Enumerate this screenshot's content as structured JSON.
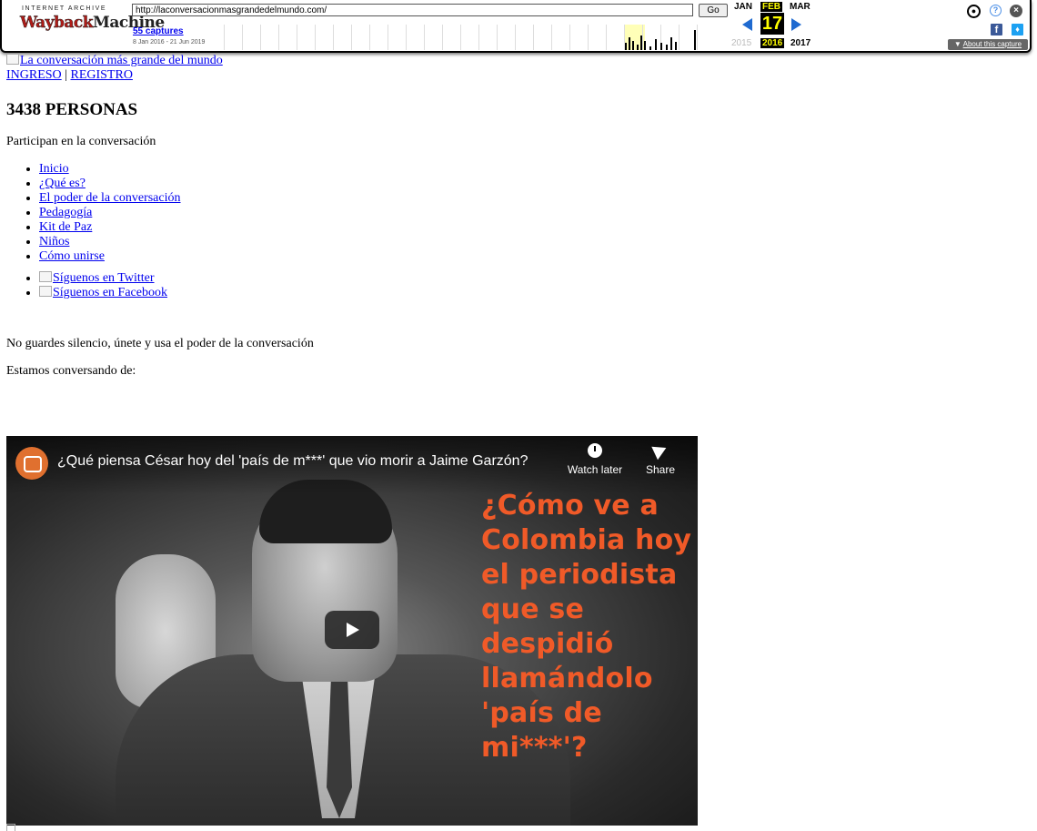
{
  "wayback": {
    "ia_label": "INTERNET ARCHIVE",
    "wb_logo_1": "Wayback",
    "wb_logo_2": "Machine",
    "url": "http://laconversacionmasgrandedelmundo.com/",
    "go_label": "Go",
    "captures": "55 captures",
    "date_range": "8 Jan 2016 - 21 Jun 2019",
    "months": {
      "prev": "JAN",
      "current": "FEB",
      "next": "MAR"
    },
    "day": "17",
    "years": {
      "prev": "2015",
      "current": "2016",
      "next": "2017"
    },
    "about": "About this capture",
    "icons": [
      "user-icon",
      "help-icon",
      "close-icon",
      "facebook-icon",
      "twitter-icon"
    ]
  },
  "site": {
    "logo_alt": "La conversación más grande del mundo",
    "login": "INGRESO",
    "separator": " | ",
    "register": "REGISTRO",
    "count_heading": "3438 PERSONAS",
    "count_sub": "Participan en la conversación",
    "nav": [
      "Inicio",
      "¿Qué es?",
      "El poder de la conversación",
      "Pedagogía",
      "Kit de Paz",
      "Niños",
      "Cómo unirse"
    ],
    "social": [
      "Síguenos en Twitter",
      "Síguenos en Facebook"
    ],
    "tagline": "No guardes silencio, únete y usa el poder de la conversación",
    "conversing": "Estamos conversando de:"
  },
  "video": {
    "title": "¿Qué piensa César hoy del 'país de m***' que vio morir a Jaime Garzón?",
    "watch_later": "Watch later",
    "share": "Share",
    "overlay_text": "¿Cómo ve a\nColombia hoy\nel periodista\nque se\ndespidió\nllamándolo\n'país de\nmi***'?",
    "accent_color": "#f05a28"
  }
}
